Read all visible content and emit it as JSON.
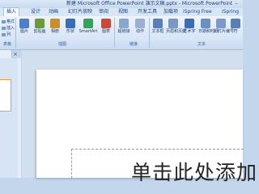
{
  "title": "新建 Microsoft Office PowerPoint 演示文稿.pptx - Microsoft PowerPoint",
  "title_prefix": "新建",
  "window_controls": {
    "minimize": "–"
  },
  "tabs": [
    {
      "label": "插入",
      "active": true
    },
    {
      "label": "设计"
    },
    {
      "label": "动画"
    },
    {
      "label": "幻灯片放映"
    },
    {
      "label": "审阅"
    },
    {
      "label": "视图"
    },
    {
      "label": "开发工具"
    },
    {
      "label": "加载项"
    },
    {
      "label": "iSpring Free"
    },
    {
      "label": "iSpring"
    }
  ],
  "ribbon": {
    "left_small": [
      "格式",
      "插入",
      "列"
    ],
    "table_label": "表格",
    "buttons": [
      {
        "label": "图片",
        "icon": "picture-icon",
        "color": "#4f7fc2"
      },
      {
        "label": "剪贴画",
        "icon": "clipart-icon",
        "color": "#6a9a3a"
      },
      {
        "label": "相册",
        "icon": "album-icon",
        "color": "#c8902a"
      },
      {
        "label": "形状",
        "icon": "shapes-icon",
        "color": "#3a6fb5"
      },
      {
        "label": "SmartArt",
        "icon": "smartart-icon",
        "color": "#3aa05c"
      },
      {
        "label": "图表",
        "icon": "chart-icon",
        "color": "#c84a3a"
      },
      {
        "label": "超链接",
        "icon": "hyperlink-icon",
        "color": "#8aa6cc"
      },
      {
        "label": "动作",
        "icon": "action-icon",
        "color": "#9ab0d0"
      },
      {
        "label": "文本框",
        "icon": "textbox-icon",
        "color": "#5a7fb6"
      },
      {
        "label": "页眉和页脚",
        "icon": "header-footer-icon",
        "color": "#7a96c2"
      },
      {
        "label": "艺术字",
        "icon": "wordart-icon",
        "color": "#3c6db4"
      },
      {
        "label": "日期和时间",
        "icon": "datetime-icon",
        "color": "#6d8fbf"
      },
      {
        "label": "幻灯片编号",
        "icon": "slide-number-icon",
        "color": "#7d9ac6"
      },
      {
        "label": "符",
        "icon": "symbol-icon",
        "color": "#5a7fb6"
      }
    ],
    "groups": {
      "illustrations": "插图",
      "links": "链接",
      "text": "文本"
    }
  },
  "left_panel": {
    "close": "×"
  },
  "slide": {
    "placeholder_text": "单击此处添加"
  }
}
